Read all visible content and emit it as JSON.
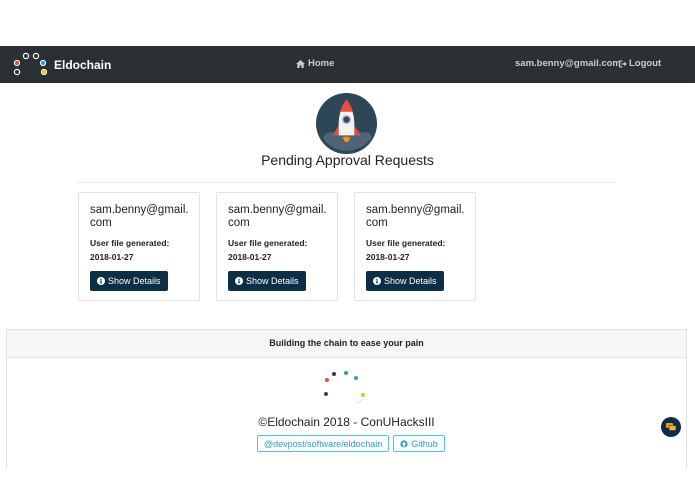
{
  "navbar": {
    "brand": "Eldochain",
    "home_label": "Home",
    "user_email": "sam.benny@gmail.com",
    "logout_label": "Logout"
  },
  "main": {
    "title": "Pending Approval Requests",
    "cards": [
      {
        "email": "sam.benny@gmail.com",
        "file_label": "User file generated:",
        "date": "2018-01-27",
        "button_label": "Show Details"
      },
      {
        "email": "sam.benny@gmail.com",
        "file_label": "User file generated:",
        "date": "2018-01-27",
        "button_label": "Show Details"
      },
      {
        "email": "sam.benny@gmail.com",
        "file_label": "User file generated:",
        "date": "2018-01-27",
        "button_label": "Show Details"
      }
    ]
  },
  "footer": {
    "tagline": "Building the chain to ease your pain",
    "copyright": "©Eldochain 2018 - ConUHacksIII",
    "devpost_label": "@devpost/software/eldochain",
    "github_label": "Github"
  },
  "colors": {
    "navbar": "#2b3035",
    "button": "#0d2e47",
    "link": "#2a9fc4",
    "rocket_circle": "#2d4759"
  },
  "icons": {
    "home": "home-icon",
    "logout": "logout-icon",
    "info": "info-icon",
    "github": "github-icon",
    "chat": "chat-icon",
    "rocket": "rocket-icon"
  }
}
